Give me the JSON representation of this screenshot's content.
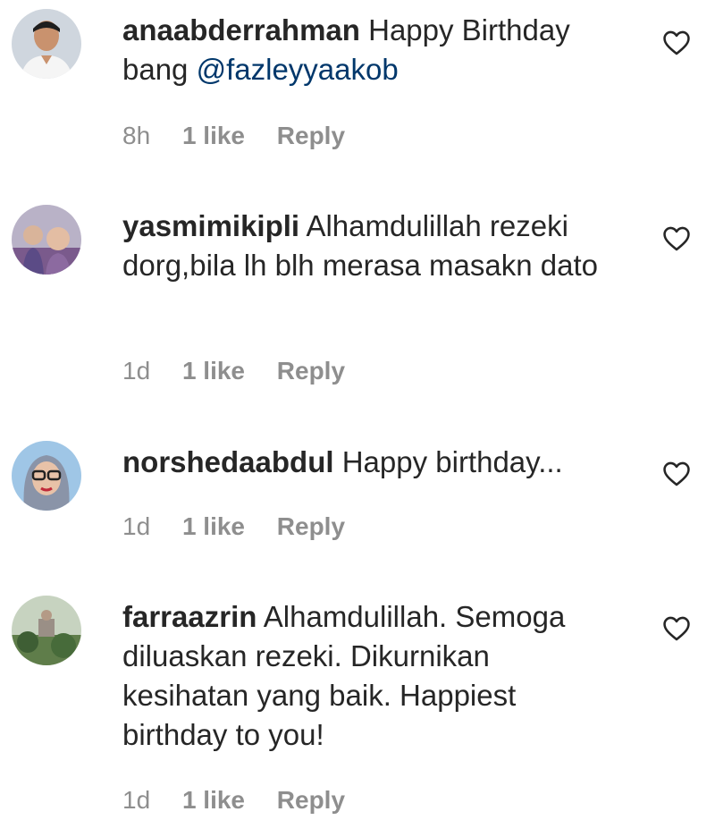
{
  "comments": [
    {
      "username": "anaabderrahman",
      "text": "Happy Birthday bang",
      "mention": "@fazleyyaakob",
      "time": "8h",
      "likes": "1 like",
      "reply": "Reply",
      "avatar_icon": "avatar-man-portrait"
    },
    {
      "username": "yasmimikipli",
      "text": "Alhamdulillah rezeki dorg,bila lh blh merasa masakn dato",
      "time": "1d",
      "likes": "1 like",
      "reply": "Reply",
      "avatar_icon": "avatar-children-photo"
    },
    {
      "username": "norshedaabdul",
      "text": "Happy birthday...",
      "time": "1d",
      "likes": "1 like",
      "reply": "Reply",
      "avatar_icon": "avatar-woman-hijab"
    },
    {
      "username": "farraazrin",
      "text": "Alhamdulillah. Semoga diluaskan rezeki. Dikurnikan kesihatan yang baik. Happiest birthday to you!",
      "time": "1d",
      "likes": "1 like",
      "reply": "Reply",
      "avatar_icon": "avatar-outdoor-photo"
    }
  ],
  "colors": {
    "text": "#262626",
    "meta": "#8e8e8e",
    "mention": "#00376b",
    "background": "#ffffff"
  },
  "icons": {
    "like": "heart-outline-icon"
  }
}
